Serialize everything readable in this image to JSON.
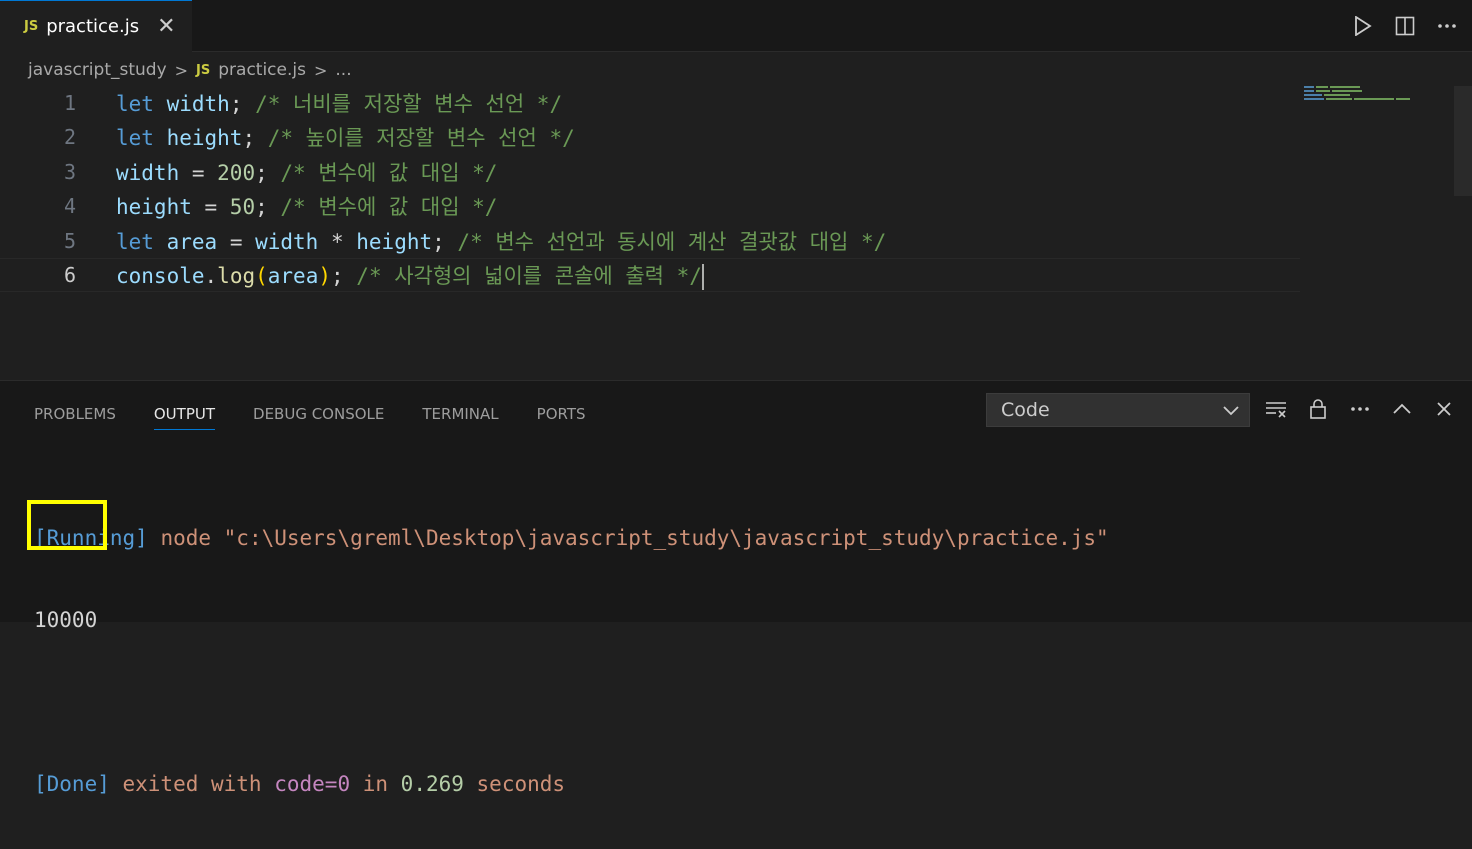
{
  "tab": {
    "badge": "JS",
    "label": "practice.js",
    "close": "✕"
  },
  "breadcrumb": {
    "folder": "javascript_study",
    "sep": ">",
    "badge": "JS",
    "file": "practice.js",
    "more": "..."
  },
  "code_lines": [
    {
      "num": "1",
      "tokens": [
        {
          "c": "kw",
          "t": "let"
        },
        {
          "c": "op",
          "t": " "
        },
        {
          "c": "var",
          "t": "width"
        },
        {
          "c": "op",
          "t": "; "
        },
        {
          "c": "cmt",
          "t": "/* 너비를 저장할 변수 선언 */"
        }
      ]
    },
    {
      "num": "2",
      "tokens": [
        {
          "c": "kw",
          "t": "let"
        },
        {
          "c": "op",
          "t": " "
        },
        {
          "c": "var",
          "t": "height"
        },
        {
          "c": "op",
          "t": "; "
        },
        {
          "c": "cmt",
          "t": "/* 높이를 저장할 변수 선언 */"
        }
      ]
    },
    {
      "num": "3",
      "tokens": [
        {
          "c": "var",
          "t": "width"
        },
        {
          "c": "op",
          "t": " = "
        },
        {
          "c": "num",
          "t": "200"
        },
        {
          "c": "op",
          "t": "; "
        },
        {
          "c": "cmt",
          "t": "/* 변수에 값 대입 */"
        }
      ]
    },
    {
      "num": "4",
      "tokens": [
        {
          "c": "var",
          "t": "height"
        },
        {
          "c": "op",
          "t": " = "
        },
        {
          "c": "num",
          "t": "50"
        },
        {
          "c": "op",
          "t": "; "
        },
        {
          "c": "cmt",
          "t": "/* 변수에 값 대입 */"
        }
      ]
    },
    {
      "num": "5",
      "tokens": [
        {
          "c": "kw",
          "t": "let"
        },
        {
          "c": "op",
          "t": " "
        },
        {
          "c": "var",
          "t": "area"
        },
        {
          "c": "op",
          "t": " = "
        },
        {
          "c": "var",
          "t": "width"
        },
        {
          "c": "op",
          "t": " * "
        },
        {
          "c": "var",
          "t": "height"
        },
        {
          "c": "op",
          "t": "; "
        },
        {
          "c": "cmt",
          "t": "/* 변수 선언과 동시에 계산 결괏값 대입 */"
        }
      ]
    },
    {
      "num": "6",
      "tokens": [
        {
          "c": "var",
          "t": "console"
        },
        {
          "c": "op",
          "t": "."
        },
        {
          "c": "fn",
          "t": "log"
        },
        {
          "c": "paren",
          "t": "("
        },
        {
          "c": "var",
          "t": "area"
        },
        {
          "c": "paren",
          "t": ")"
        },
        {
          "c": "op",
          "t": "; "
        },
        {
          "c": "cmt",
          "t": "/* 사각형의 넓이를 콘솔에 출력 */"
        }
      ]
    }
  ],
  "panel": {
    "tabs": [
      "PROBLEMS",
      "OUTPUT",
      "DEBUG CONSOLE",
      "TERMINAL",
      "PORTS"
    ],
    "active_tab": "OUTPUT",
    "dropdown_value": "Code"
  },
  "output": {
    "running_tag": "[Running]",
    "running_cmd": " node \"c:\\Users\\greml\\Desktop\\javascript_study\\javascript_study\\practice.js\"",
    "result": "10000",
    "done_tag": "[Done]",
    "done_pre": " exited with ",
    "done_code": "code=0",
    "done_in": " in ",
    "done_secs": "0.269",
    "done_post": " seconds"
  },
  "colors": {
    "accent": "#0078d4",
    "highlight": "#ffff00"
  }
}
